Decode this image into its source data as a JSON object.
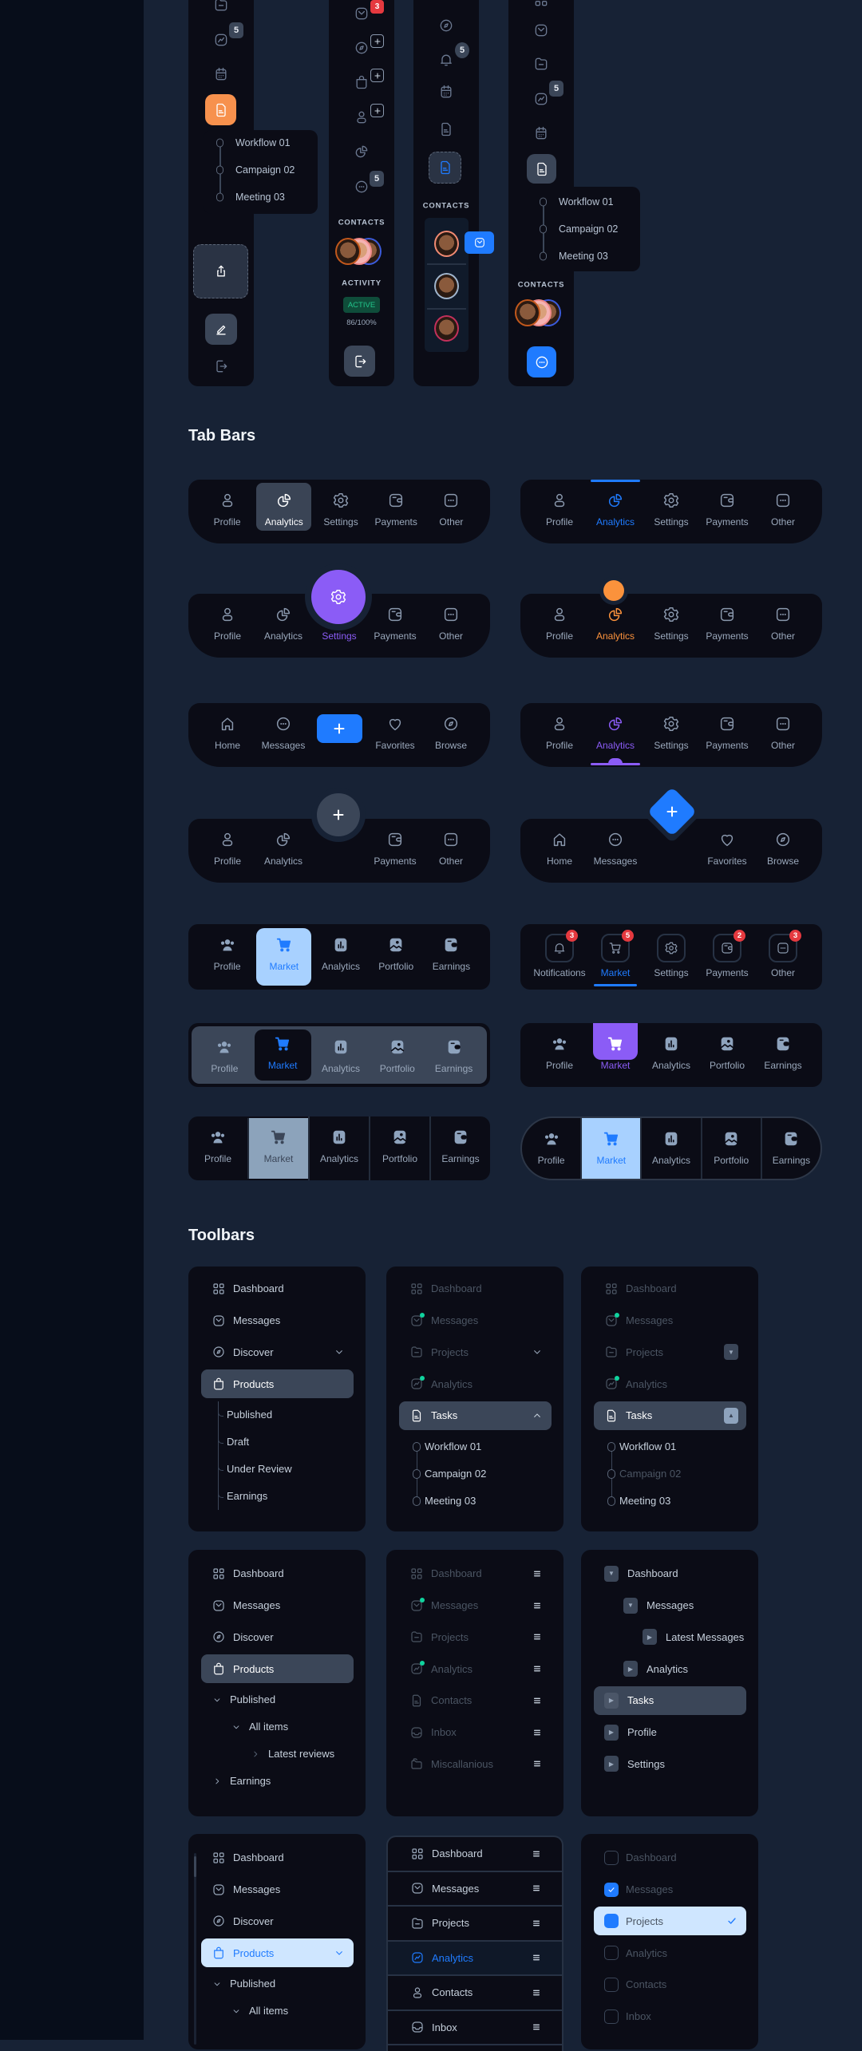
{
  "colors": {
    "page_bg": "#172235",
    "panel_bg": "#0b0c16",
    "highlight": "#3b4658",
    "blue": "#1f7bff",
    "purple": "#8b5cf6",
    "orange": "#fb923c",
    "red_badge": "#e5393f",
    "green": "#10d39e"
  },
  "sidebars": [
    {
      "badge": "5",
      "timeline": [
        "Workflow 01",
        "Campaign 02",
        "Meeting 03"
      ]
    },
    {
      "mail_badge": "3",
      "chat_badge": "5",
      "contacts_label": "CONTACTS",
      "activity_label": "ACTIVITY",
      "status": "ACTIVE",
      "progress_text": "86/100%",
      "progress": 0.86
    },
    {
      "bell_badge": "5",
      "contacts_label": "CONTACTS"
    },
    {
      "badge": "5",
      "timeline": [
        "Workflow 01",
        "Campaign 02",
        "Meeting 03"
      ],
      "contacts_label": "CONTACTS"
    }
  ],
  "sections": {
    "tab_bars": "Tab Bars",
    "toolbars": "Toolbars"
  },
  "tab_bars": [
    {
      "variant": "pill-active",
      "active": 1,
      "items": [
        {
          "label": "Profile",
          "icon": "user"
        },
        {
          "label": "Analytics",
          "icon": "pie"
        },
        {
          "label": "Settings",
          "icon": "gear"
        },
        {
          "label": "Payments",
          "icon": "wallet"
        },
        {
          "label": "Other",
          "icon": "more"
        }
      ]
    },
    {
      "variant": "top-line",
      "active": 1,
      "accent": "#1f7bff",
      "items": [
        {
          "label": "Profile",
          "icon": "user"
        },
        {
          "label": "Analytics",
          "icon": "pie"
        },
        {
          "label": "Settings",
          "icon": "gear"
        },
        {
          "label": "Payments",
          "icon": "wallet"
        },
        {
          "label": "Other",
          "icon": "more"
        }
      ]
    },
    {
      "variant": "fab-circle",
      "active": 2,
      "accent": "#8b5cf6",
      "items": [
        {
          "label": "Profile",
          "icon": "user"
        },
        {
          "label": "Analytics",
          "icon": "pie"
        },
        {
          "label": "Settings",
          "icon": "gear"
        },
        {
          "label": "Payments",
          "icon": "wallet"
        },
        {
          "label": "Other",
          "icon": "more"
        }
      ]
    },
    {
      "variant": "dot-notch",
      "active": 1,
      "accent": "#fb923c",
      "items": [
        {
          "label": "Profile",
          "icon": "user"
        },
        {
          "label": "Analytics",
          "icon": "pie"
        },
        {
          "label": "Settings",
          "icon": "gear"
        },
        {
          "label": "Payments",
          "icon": "wallet"
        },
        {
          "label": "Other",
          "icon": "more"
        }
      ]
    },
    {
      "variant": "center-button",
      "accent": "#1f7bff",
      "items": [
        {
          "label": "Home",
          "icon": "home"
        },
        {
          "label": "Messages",
          "icon": "chat"
        },
        {
          "icon": "plus",
          "button": true
        },
        {
          "label": "Favorites",
          "icon": "heart"
        },
        {
          "label": "Browse",
          "icon": "compass"
        }
      ]
    },
    {
      "variant": "bottom-line",
      "active": 1,
      "accent": "#8b5cf6",
      "items": [
        {
          "label": "Profile",
          "icon": "user"
        },
        {
          "label": "Analytics",
          "icon": "pie"
        },
        {
          "label": "Settings",
          "icon": "gear"
        },
        {
          "label": "Payments",
          "icon": "wallet"
        },
        {
          "label": "Other",
          "icon": "more"
        }
      ]
    },
    {
      "variant": "fab-grey",
      "accent": "#3b4658",
      "fab_icon": "plus",
      "items": [
        {
          "label": "Profile",
          "icon": "user"
        },
        {
          "label": "Analytics",
          "icon": "pie"
        },
        {
          "spacer": true
        },
        {
          "label": "Payments",
          "icon": "wallet"
        },
        {
          "label": "Other",
          "icon": "more"
        }
      ]
    },
    {
      "variant": "fab-diamond",
      "accent": "#1f7bff",
      "fab_icon": "plus",
      "items": [
        {
          "label": "Home",
          "icon": "home"
        },
        {
          "label": "Messages",
          "icon": "chat"
        },
        {
          "spacer": true
        },
        {
          "label": "Favorites",
          "icon": "heart"
        },
        {
          "label": "Browse",
          "icon": "compass"
        }
      ]
    },
    {
      "variant": "filled-light",
      "active": 1,
      "accent": "#1f7bff",
      "items": [
        {
          "label": "Profile",
          "icon": "people"
        },
        {
          "label": "Market",
          "icon": "cartf"
        },
        {
          "label": "Analytics",
          "icon": "barsf"
        },
        {
          "label": "Portfolio",
          "icon": "imagef"
        },
        {
          "label": "Earnings",
          "icon": "walletf"
        }
      ]
    },
    {
      "variant": "boxed-badges",
      "active": 1,
      "accent": "#1f7bff",
      "items": [
        {
          "label": "Notifications",
          "icon": "bell",
          "badge": "3"
        },
        {
          "label": "Market",
          "icon": "cart",
          "badge": "5"
        },
        {
          "label": "Settings",
          "icon": "gear"
        },
        {
          "label": "Payments",
          "icon": "wallet",
          "badge": "2"
        },
        {
          "label": "Other",
          "icon": "more",
          "badge": "3"
        }
      ]
    },
    {
      "variant": "inset-panel",
      "active": 1,
      "accent": "#1f7bff",
      "items": [
        {
          "label": "Profile",
          "icon": "people"
        },
        {
          "label": "Market",
          "icon": "cartf"
        },
        {
          "label": "Analytics",
          "icon": "barsf"
        },
        {
          "label": "Portfolio",
          "icon": "imagef"
        },
        {
          "label": "Earnings",
          "icon": "walletf"
        }
      ]
    },
    {
      "variant": "purple-tab",
      "active": 1,
      "accent": "#8b5cf6",
      "items": [
        {
          "label": "Profile",
          "icon": "people"
        },
        {
          "label": "Market",
          "icon": "cartf"
        },
        {
          "label": "Analytics",
          "icon": "barsf"
        },
        {
          "label": "Portfolio",
          "icon": "imagef"
        },
        {
          "label": "Earnings",
          "icon": "walletf"
        }
      ]
    },
    {
      "variant": "cells",
      "active": 1,
      "items": [
        {
          "label": "Profile",
          "icon": "people"
        },
        {
          "label": "Market",
          "icon": "cartf"
        },
        {
          "label": "Analytics",
          "icon": "barsf"
        },
        {
          "label": "Portfolio",
          "icon": "imagef"
        },
        {
          "label": "Earnings",
          "icon": "walletf"
        }
      ]
    },
    {
      "variant": "pill-cells",
      "active": 1,
      "accent": "#1f7bff",
      "items": [
        {
          "label": "Profile",
          "icon": "people"
        },
        {
          "label": "Market",
          "icon": "cartf"
        },
        {
          "label": "Analytics",
          "icon": "barsf"
        },
        {
          "label": "Portfolio",
          "icon": "imagef"
        },
        {
          "label": "Earnings",
          "icon": "walletf"
        }
      ]
    }
  ],
  "toolbars": [
    {
      "rows": [
        {
          "label": "Dashboard",
          "icon": "grid"
        },
        {
          "label": "Messages",
          "icon": "mail"
        },
        {
          "label": "Discover",
          "icon": "compass",
          "trail": "chev-down"
        },
        {
          "label": "Products",
          "icon": "bag",
          "state": "active"
        },
        {
          "label": "Published",
          "lead": "tree",
          "sub": true
        },
        {
          "label": "Draft",
          "lead": "tree",
          "sub": true
        },
        {
          "label": "Under Review",
          "lead": "tree",
          "sub": true
        },
        {
          "label": "Earnings",
          "lead": "tree",
          "sub": true
        }
      ]
    },
    {
      "rows": [
        {
          "label": "Dashboard",
          "icon": "grid",
          "state": "dim"
        },
        {
          "label": "Messages",
          "icon": "mail",
          "state": "dim",
          "dot": true
        },
        {
          "label": "Projects",
          "icon": "folder",
          "state": "dim",
          "trail": "chev-down"
        },
        {
          "label": "Analytics",
          "icon": "chart",
          "state": "dim",
          "dot": true
        },
        {
          "label": "Tasks",
          "icon": "doc",
          "state": "active",
          "trail": "chev-up"
        },
        {
          "label": "Workflow 01",
          "lead": "tl",
          "sub": true
        },
        {
          "label": "Campaign 02",
          "lead": "tl",
          "sub": true
        },
        {
          "label": "Meeting 03",
          "lead": "tl",
          "sub": true
        }
      ]
    },
    {
      "rows": [
        {
          "label": "Dashboard",
          "icon": "grid",
          "state": "dim"
        },
        {
          "label": "Messages",
          "icon": "mail",
          "state": "dim",
          "dot": true
        },
        {
          "label": "Projects",
          "icon": "folder",
          "state": "dim",
          "trail": "caret-down"
        },
        {
          "label": "Analytics",
          "icon": "chart",
          "state": "dim",
          "dot": true
        },
        {
          "label": "Tasks",
          "icon": "doc",
          "state": "active",
          "trail": "caret-up"
        },
        {
          "label": "Workflow 01",
          "lead": "tl",
          "sub": true
        },
        {
          "label": "Campaign 02",
          "lead": "tl",
          "sub": true,
          "state": "faint"
        },
        {
          "label": "Meeting 03",
          "lead": "tl",
          "sub": true
        }
      ]
    },
    {
      "rows": [
        {
          "label": "Dashboard",
          "icon": "grid"
        },
        {
          "label": "Messages",
          "icon": "mail"
        },
        {
          "label": "Discover",
          "icon": "compass"
        },
        {
          "label": "Products",
          "icon": "bag",
          "state": "active"
        },
        {
          "label": "Published",
          "lead": "chev-down",
          "sub": true
        },
        {
          "label": "All items",
          "lead": "chev-down",
          "sub": true,
          "level": 1
        },
        {
          "label": "Latest reviews",
          "lead": "chev-right",
          "sub": true,
          "level": 2
        },
        {
          "label": "Earnings",
          "lead": "chev-right",
          "sub": true
        }
      ]
    },
    {
      "rows": [
        {
          "label": "Dashboard",
          "icon": "grid",
          "state": "dim",
          "trail": "menu"
        },
        {
          "label": "Messages",
          "icon": "mail",
          "state": "dim",
          "dot": true,
          "trail": "menu"
        },
        {
          "label": "Projects",
          "icon": "folder",
          "state": "dim",
          "trail": "menu"
        },
        {
          "label": "Analytics",
          "icon": "chart",
          "state": "dim",
          "dot": true,
          "trail": "menu"
        },
        {
          "label": "Contacts",
          "icon": "doc",
          "state": "dim",
          "trail": "menu"
        },
        {
          "label": "Inbox",
          "icon": "inbox",
          "state": "dim",
          "trail": "menu"
        },
        {
          "label": "Miscallanious",
          "icon": "folders",
          "state": "dim",
          "trail": "menu"
        }
      ]
    },
    {
      "rows": [
        {
          "label": "Dashboard",
          "lead": "caret-down"
        },
        {
          "label": "Messages",
          "lead": "caret-down",
          "level": 1
        },
        {
          "label": "Latest Messages",
          "lead": "caret-right",
          "level": 2
        },
        {
          "label": "Analytics",
          "lead": "caret-right",
          "level": 1
        },
        {
          "label": "Tasks",
          "lead": "caret-right",
          "state": "active"
        },
        {
          "label": "Profile",
          "lead": "caret-right"
        },
        {
          "label": "Settings",
          "lead": "caret-right"
        }
      ]
    },
    {
      "rows": [
        {
          "label": "Dashboard",
          "icon": "grid"
        },
        {
          "label": "Messages",
          "icon": "mail"
        },
        {
          "label": "Discover",
          "icon": "compass"
        },
        {
          "label": "Products",
          "icon": "bag",
          "state": "light",
          "trail": "chev-down"
        },
        {
          "label": "Published",
          "lead": "chev-down",
          "sub": true
        },
        {
          "label": "All items",
          "lead": "chev-down",
          "sub": true,
          "level": 1
        }
      ]
    },
    {
      "bordered": true,
      "rows": [
        {
          "label": "Dashboard",
          "icon": "grid",
          "trail": "menu"
        },
        {
          "label": "Messages",
          "icon": "mail",
          "trail": "menu"
        },
        {
          "label": "Projects",
          "icon": "folder",
          "trail": "menu"
        },
        {
          "label": "Analytics",
          "icon": "chart",
          "state": "sel",
          "trail": "menu"
        },
        {
          "label": "Contacts",
          "icon": "user",
          "trail": "menu"
        },
        {
          "label": "Inbox",
          "icon": "inbox",
          "trail": "menu"
        }
      ]
    },
    {
      "rows": [
        {
          "label": "Dashboard",
          "lead": "checkbox",
          "state": "faint"
        },
        {
          "label": "Messages",
          "lead": "checkbox-on",
          "state": "faint"
        },
        {
          "label": "Projects",
          "lead": "checkbox-on",
          "state": "check-light",
          "trail": "check"
        },
        {
          "label": "Analytics",
          "lead": "checkbox",
          "state": "faint"
        },
        {
          "label": "Contacts",
          "lead": "checkbox",
          "state": "faint"
        },
        {
          "label": "Inbox",
          "lead": "checkbox",
          "state": "faint"
        }
      ]
    }
  ]
}
